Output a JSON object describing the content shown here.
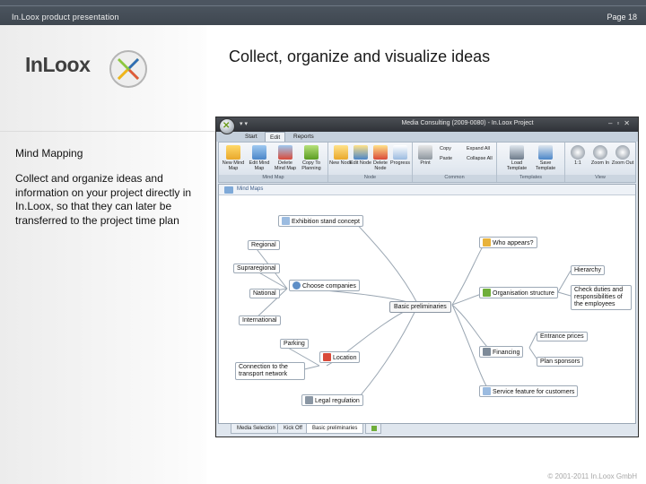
{
  "header": {
    "left_title": "In.Loox product presentation",
    "page_label": "Page 18"
  },
  "logo": {
    "text": "InLoox"
  },
  "slide": {
    "title": "Collect, organize and visualize ideas",
    "subheading": "Mind Mapping",
    "body": "Collect and organize ideas and information on your project directly in In.Loox, so that they can later be transferred to the project time plan"
  },
  "footer": {
    "copyright": "© 2001-2011 In.Loox GmbH"
  },
  "app": {
    "window_title": "Media Consulting (2009-0080) - In.Loox Project",
    "ribbon_tabs": [
      "Start",
      "Edit",
      "Reports"
    ],
    "active_tab": "Edit",
    "groups": {
      "mind_map": {
        "label": "Mind Map",
        "buttons": [
          "New Mind Map",
          "Edit Mind Map",
          "Delete Mind Map",
          "Copy To Planning"
        ]
      },
      "node": {
        "label": "Node",
        "buttons": [
          "New Node",
          "Edit Node",
          "Delete Node",
          "Progress"
        ]
      },
      "common": {
        "label": "Common",
        "buttons": [
          "Print"
        ],
        "small": [
          "Copy",
          "Paste",
          "Expand All",
          "Collapse All"
        ]
      },
      "templates": {
        "label": "Templates",
        "buttons": [
          "Load Template",
          "Save Template"
        ]
      },
      "view": {
        "label": "View",
        "buttons": [
          "1:1",
          "Zoom In",
          "Zoom Out"
        ]
      }
    },
    "canvas_tab": "Mind Maps",
    "nodes": {
      "center": "Basic preliminaries",
      "exhibition": "Exhibition stand concept",
      "regional": "Regional",
      "supraregional": "Supraregional",
      "national": "National",
      "international": "International",
      "choose_companies": "Choose companies",
      "parking": "Parking",
      "connection": "Connection to the transport network",
      "location": "Location",
      "legal": "Legal regulation",
      "who_appears": "Who appears?",
      "hierarchy": "Hierarchy",
      "check_duties": "Check duties and responsibilities of the employees",
      "org_structure": "Organisation structure",
      "entrance_prices": "Entrance prices",
      "financing": "Financing",
      "plan_sponsors": "Plan sponsors",
      "service": "Service feature for customers"
    },
    "sheet_tabs": [
      "Media Selection",
      "Kick Off",
      "Basic preliminaries"
    ],
    "active_sheet": "Basic preliminaries"
  },
  "colors": {
    "topbar": "#4a535d",
    "accent_green": "#7bb31a",
    "accent_blue": "#2f6db5"
  }
}
